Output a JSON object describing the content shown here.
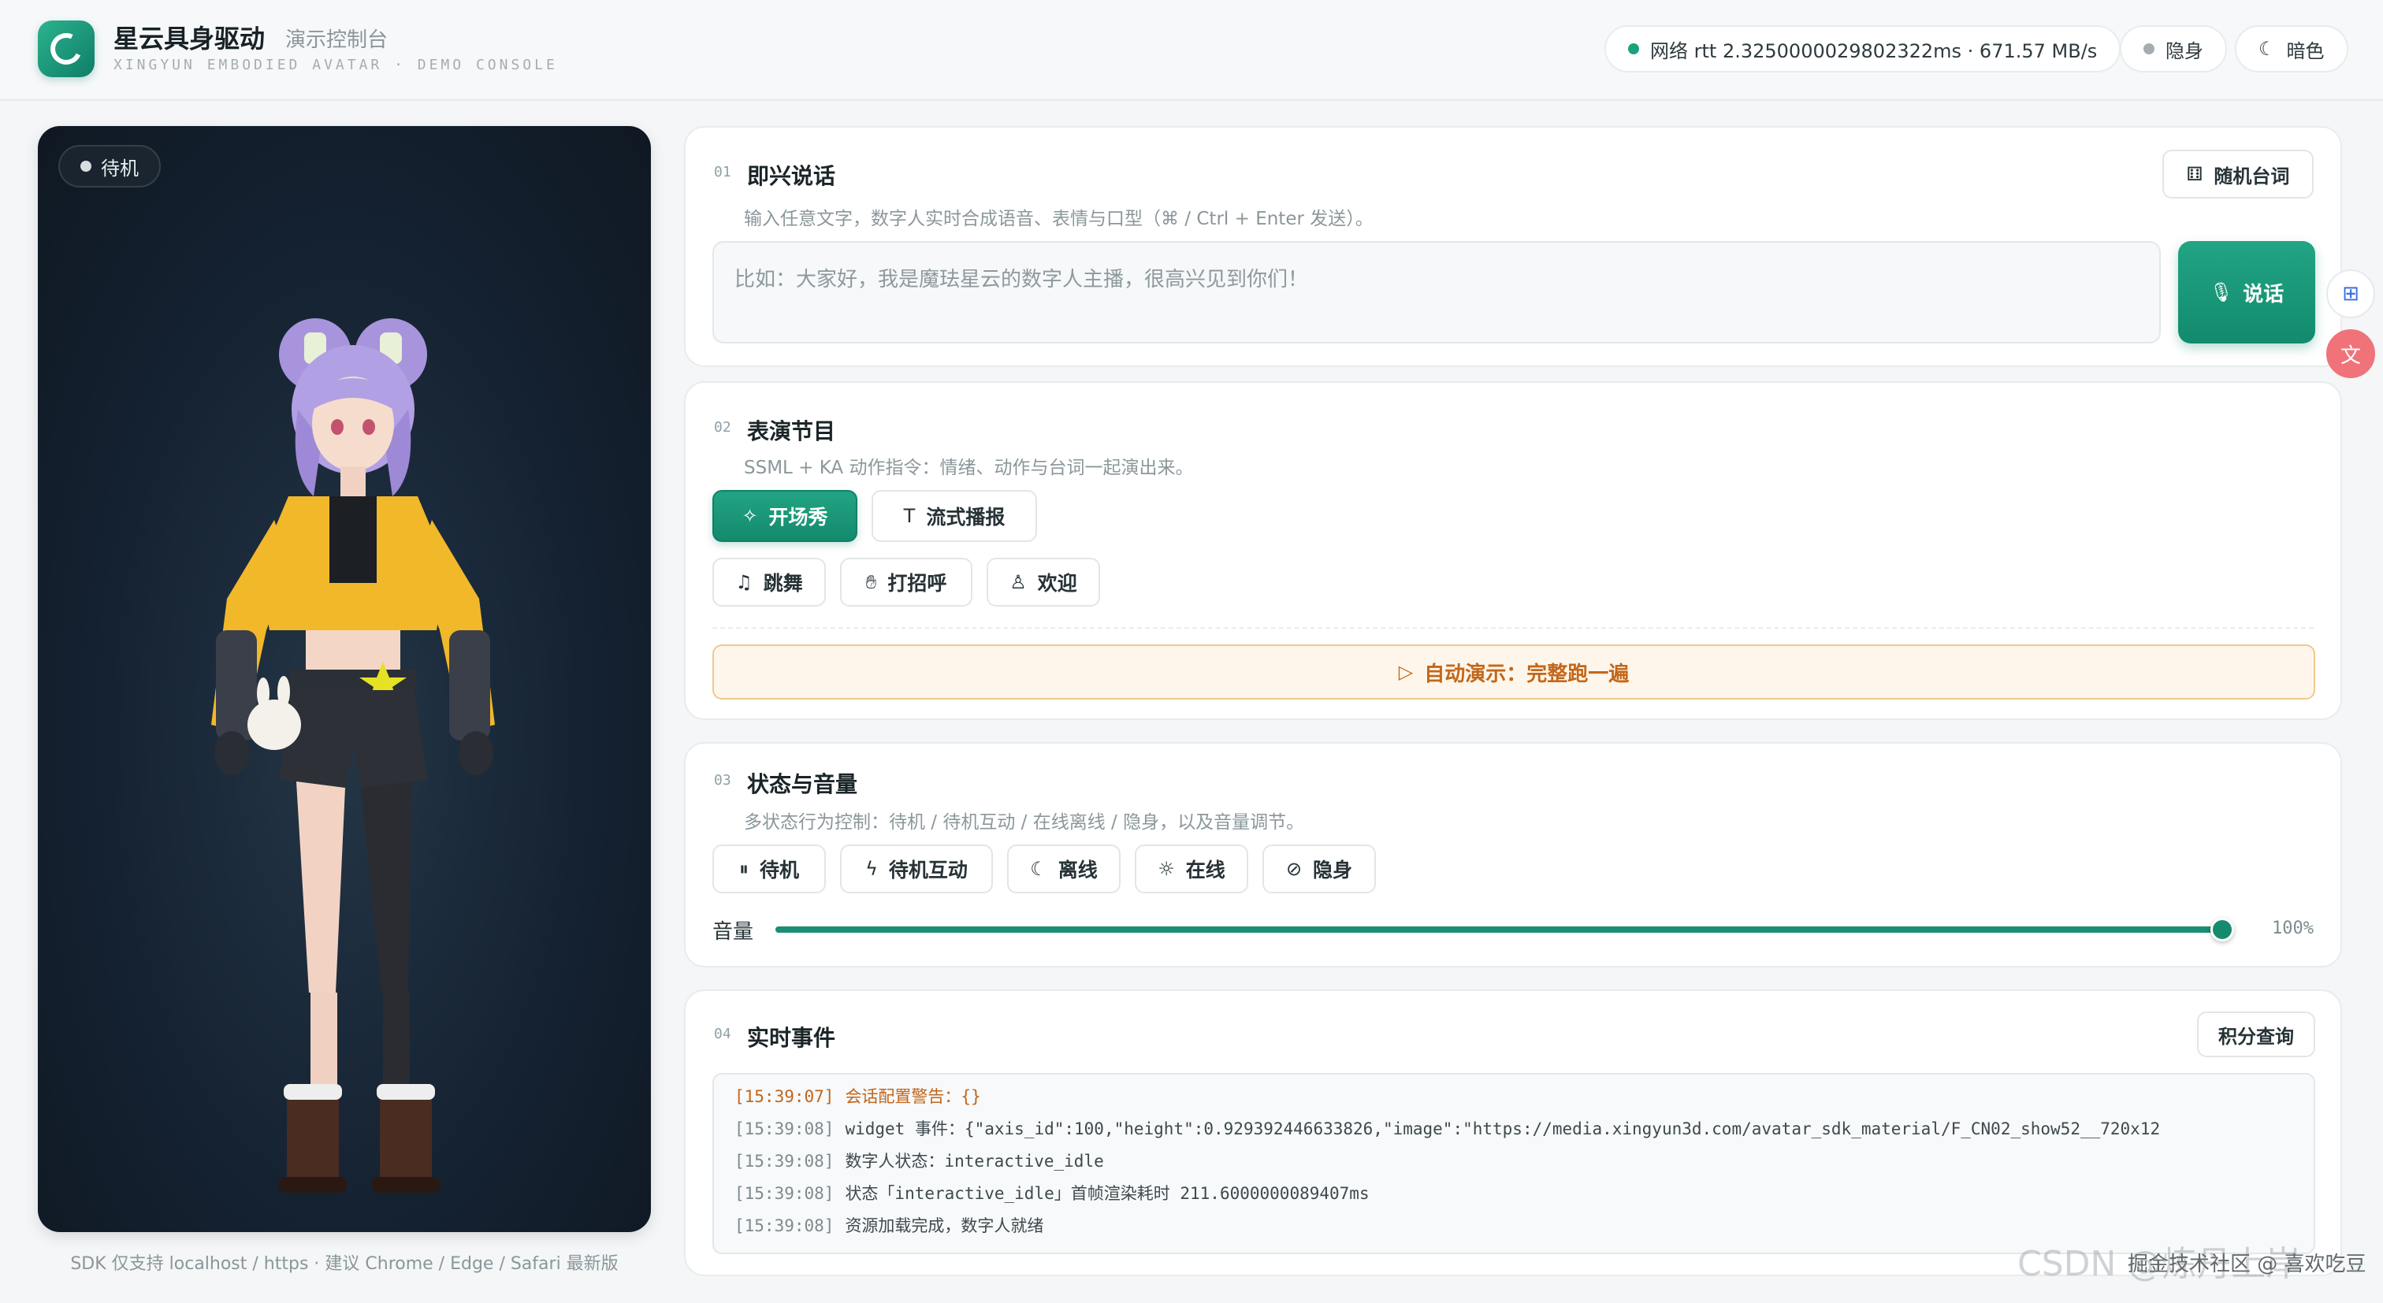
{
  "header": {
    "title": "星云具身驱动",
    "subtitle": "演示控制台",
    "tagline": "XINGYUN EMBODIED AVATAR · DEMO CONSOLE",
    "network_status": "网络 rtt 2.3250000029802322ms · 671.57 MB/s",
    "stealth_label": "隐身",
    "theme_label": "暗色"
  },
  "avatar": {
    "state_label": "待机",
    "footnote": "SDK 仅支持 localhost / https · 建议 Chrome / Edge / Safari 最新版"
  },
  "sections": {
    "speak": {
      "num": "01",
      "title": "即兴说话",
      "desc": "输入任意文字，数字人实时合成语音、表情与口型（⌘ / Ctrl + Enter 发送）。",
      "random_label": "随机台词",
      "placeholder": "比如：大家好，我是魔珐星云的数字人主播，很高兴见到你们！",
      "speak_label": "说话"
    },
    "perform": {
      "num": "02",
      "title": "表演节目",
      "desc": "SSML + KA 动作指令：情绪、动作与台词一起演出来。",
      "opening_label": "开场秀",
      "stream_label": "流式播报",
      "dance_label": "跳舞",
      "greet_label": "打招呼",
      "welcome_label": "欢迎",
      "auto_label": "自动演示：完整跑一遍"
    },
    "state": {
      "num": "03",
      "title": "状态与音量",
      "desc": "多状态行为控制：待机 / 待机互动 / 在线离线 / 隐身，以及音量调节。",
      "idle_label": "待机",
      "idle_interact_label": "待机互动",
      "offline_label": "离线",
      "online_label": "在线",
      "hidden_label": "隐身",
      "volume_label": "音量",
      "volume_value": 100,
      "volume_text": "100%"
    },
    "events": {
      "num": "04",
      "title": "实时事件",
      "points_label": "积分查询",
      "log": [
        {
          "time": "[15:39:07]",
          "text": "会话配置警告：{}",
          "level": "warn"
        },
        {
          "time": "[15:39:08]",
          "text": "widget 事件：{\"axis_id\":100,\"height\":0.929392446633826,\"image\":\"https://media.xingyun3d.com/avatar_sdk_material/F_CN02_show52__720x12",
          "level": "info"
        },
        {
          "time": "[15:39:08]",
          "text": "数字人状态：interactive_idle",
          "level": "info"
        },
        {
          "time": "[15:39:08]",
          "text": "状态「interactive_idle」首帧渲染耗时 211.6000000089407ms",
          "level": "info"
        },
        {
          "time": "[15:39:08]",
          "text": "资源加载完成，数字人就绪",
          "level": "info"
        }
      ]
    }
  },
  "watermark": {
    "main": "CSDN @炼丹上岸",
    "secondary": "掘金技术社区 @ 喜欢吃豆"
  },
  "colors": {
    "accent": "#168a6d",
    "warn": "#c2651a",
    "online_dot": "#19a37c",
    "idle_dot": "#a5adb1"
  },
  "icons": [
    "dice-icon",
    "mic-icon",
    "sparkle-icon",
    "text-icon",
    "music-icon",
    "hand-icon",
    "person-icon",
    "play-icon",
    "pause-circle-icon",
    "bolt-icon",
    "moon-icon",
    "sun-icon",
    "eye-off-icon",
    "apps-icon",
    "translate-icon"
  ]
}
